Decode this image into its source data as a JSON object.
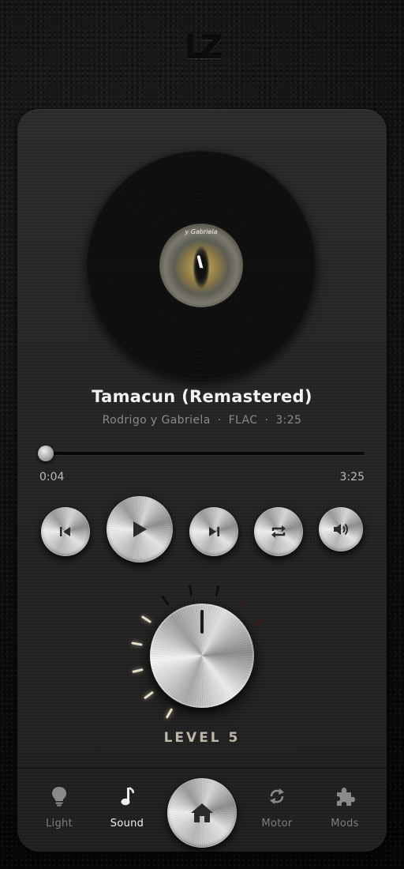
{
  "brand": {
    "logo_text": "LZ"
  },
  "track": {
    "title": "Tamacun  (Remastered)",
    "artist": "Rodrigo y Gabriela",
    "format": "FLAC",
    "duration": "3:25",
    "separator": "·",
    "album_label_text": "y Gabriela"
  },
  "progress": {
    "elapsed": "0:04",
    "total": "3:25",
    "fraction": 0.02
  },
  "controls": {
    "previous": "previous-icon",
    "play": "play-icon",
    "next": "next-icon",
    "repeat": "repeat-icon",
    "volume": "volume-icon"
  },
  "knob": {
    "level_label": "LEVEL 5",
    "level": 5,
    "max_level": 10
  },
  "nav": {
    "items": [
      {
        "label": "Light",
        "icon": "bulb-icon",
        "active": false
      },
      {
        "label": "Sound",
        "icon": "music-note-icon",
        "active": true
      },
      {
        "label": "",
        "icon": "home-icon",
        "active": false
      },
      {
        "label": "Motor",
        "icon": "sync-icon",
        "active": false
      },
      {
        "label": "Mods",
        "icon": "puzzle-icon",
        "active": false
      }
    ]
  },
  "colors": {
    "panel": "#242424",
    "accent_glow": "#e8dfc8",
    "text_primary": "#f2f2f2",
    "text_secondary": "#8a8a8a"
  }
}
